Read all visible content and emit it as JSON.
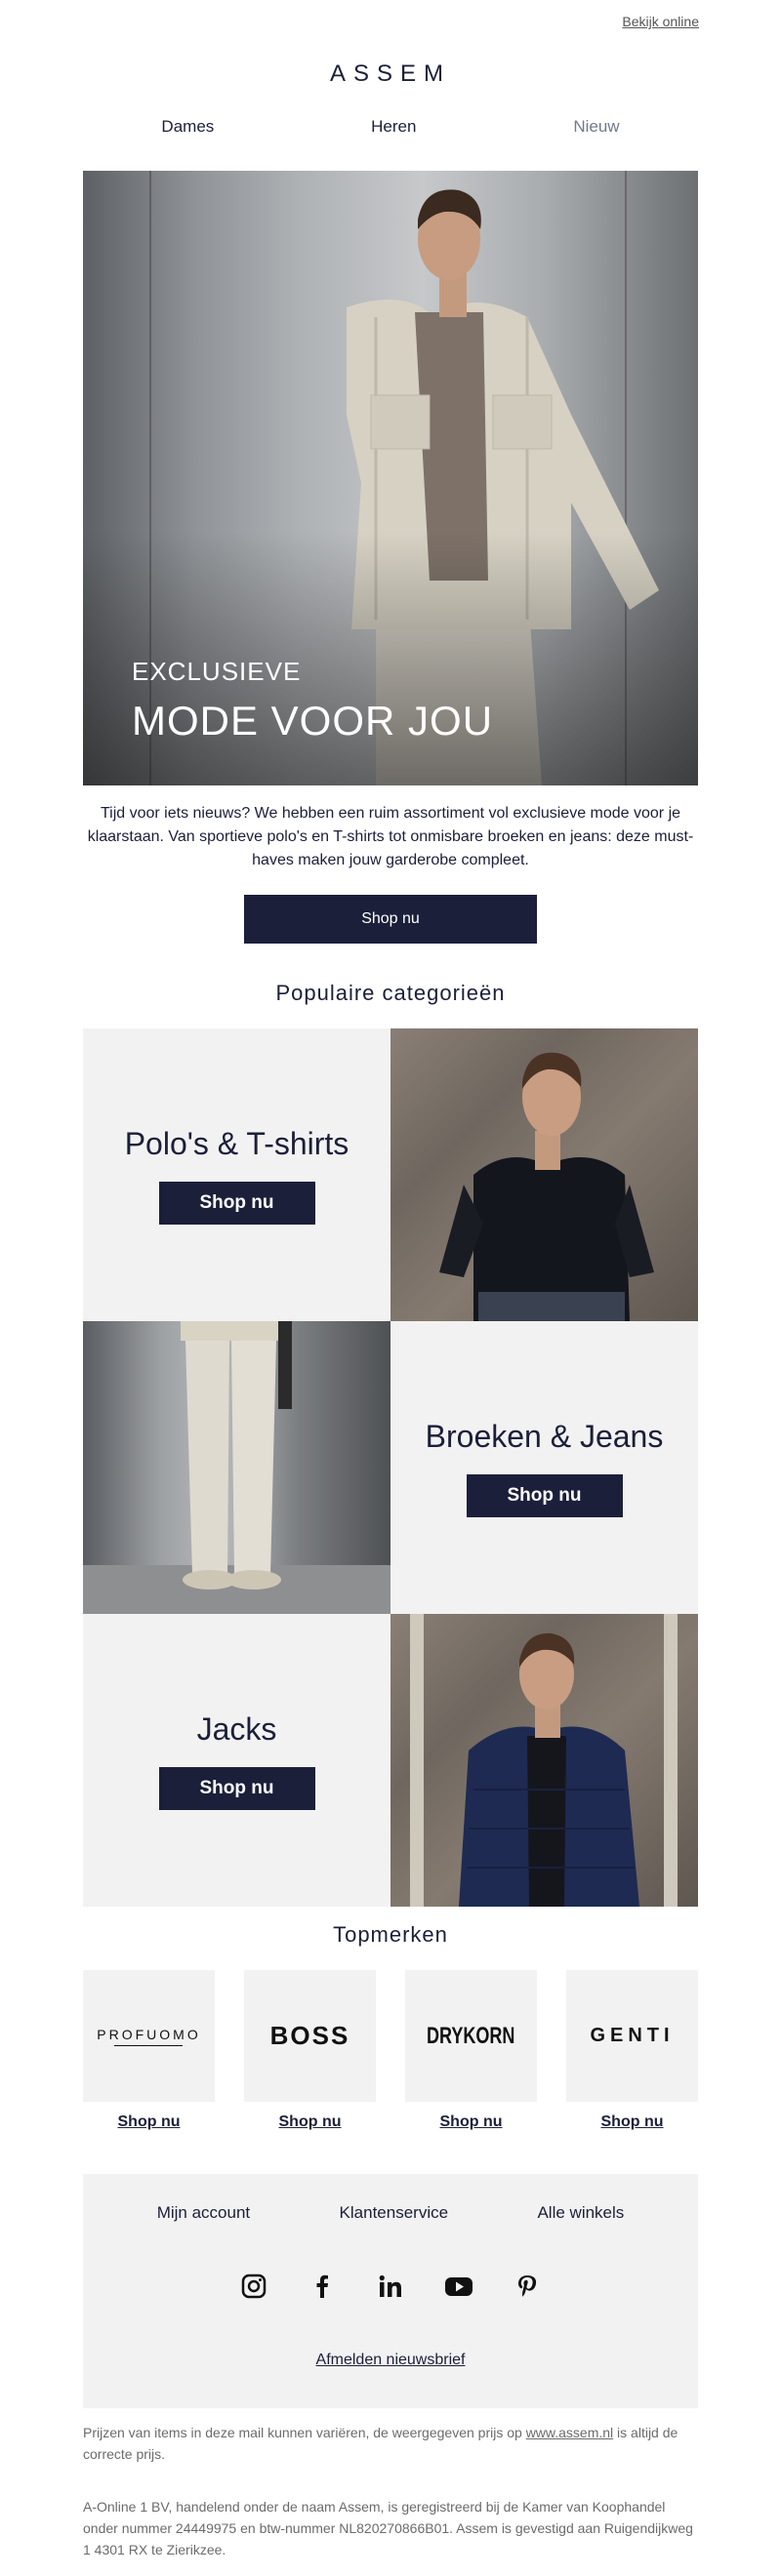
{
  "header": {
    "view_online": "Bekijk online",
    "logo": "ASSEM",
    "nav": [
      "Dames",
      "Heren",
      "Nieuw"
    ]
  },
  "hero": {
    "kicker": "EXCLUSIEVE",
    "title": "MODE VOOR JOU",
    "intro": "Tijd voor iets nieuws? We hebben een ruim assortiment vol exclusieve mode voor je klaarstaan. Van sportieve polo's en T-shirts tot onmisbare broeken en jeans: deze must-haves maken jouw garderobe compleet.",
    "cta": "Shop nu"
  },
  "categories": {
    "title": "Populaire categorieën",
    "items": [
      {
        "label": "Polo's & T-shirts",
        "cta": "Shop nu"
      },
      {
        "label": "Broeken & Jeans",
        "cta": "Shop nu"
      },
      {
        "label": "Jacks",
        "cta": "Shop nu"
      }
    ]
  },
  "brands": {
    "title": "Topmerken",
    "items": [
      {
        "name": "PROFUOMO",
        "cta": "Shop nu"
      },
      {
        "name": "BOSS",
        "cta": "Shop nu"
      },
      {
        "name": "DRYKORN",
        "cta": "Shop nu"
      },
      {
        "name": "GENTI",
        "cta": "Shop nu"
      }
    ]
  },
  "footer": {
    "links": [
      "Mijn account",
      "Klantenservice",
      "Alle winkels"
    ],
    "socials": [
      "instagram-icon",
      "facebook-icon",
      "linkedin-icon",
      "youtube-icon",
      "pinterest-icon"
    ],
    "unsubscribe": "Afmelden nieuwsbrief",
    "price_note_before": "Prijzen van items in deze mail kunnen variëren, de weergegeven prijs op ",
    "price_note_link": "www.assem.nl",
    "price_note_after": " is altijd de correcte prijs.",
    "legal": "A-Online 1 BV, handelend onder de naam Assem, is geregistreerd bij de Kamer van Koophandel onder nummer 24449975 en btw-nummer NL820270866B01. Assem is gevestigd aan Ruigendijkweg 1 4301 RX te Zierikzee."
  },
  "colors": {
    "navy": "#1b1f3a",
    "panel": "#f2f2f2"
  }
}
